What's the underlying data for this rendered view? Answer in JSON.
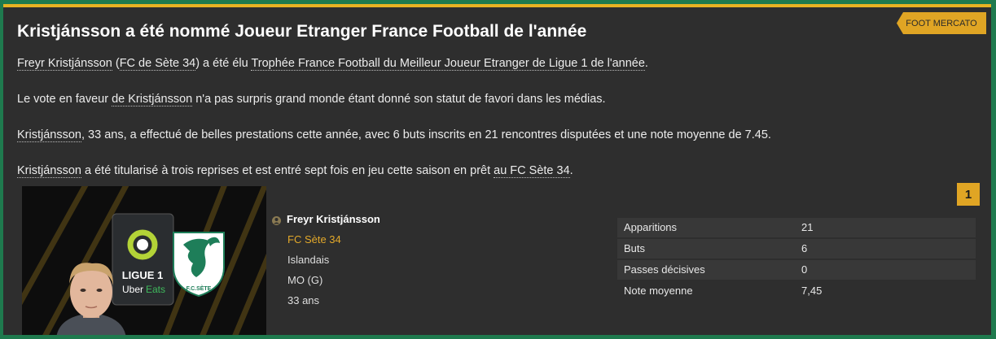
{
  "source": "FOOT MERCATO",
  "headline": "Kristjánsson a été nommé Joueur Etranger France Football de l'année",
  "paragraphs": {
    "p1": {
      "player": "Freyr Kristjánsson",
      "open_paren": " (",
      "club": "FC de Sète 34",
      "middle": ") a été élu ",
      "award": "Trophée France Football du Meilleur Joueur Etranger de Ligue 1 de l'année",
      "end": "."
    },
    "p2": {
      "start": "Le vote en faveur ",
      "player": "de Kristjánsson",
      "end": " n'a pas surpris grand monde étant donné son statut de favori dans les médias."
    },
    "p3": {
      "player": "Kristjánsson",
      "end": ", 33 ans, a effectué de belles prestations cette année, avec 6 buts inscrits en 21 rencontres disputées et une note moyenne de 7.45."
    },
    "p4": {
      "player": "Kristjánsson",
      "middle": " a été titularisé à trois reprises et est entré sept fois en jeu cette saison en prêt ",
      "club": "au FC Sète 34",
      "end": "."
    }
  },
  "rank": "1",
  "league_logo": {
    "line1": "LIGUE 1",
    "sponsor1": "Uber",
    "sponsor2": "Eats"
  },
  "club_logo": {
    "text": "F.C.SÈTE"
  },
  "player_info": {
    "name": "Freyr Kristjánsson",
    "club": "FC Sète 34",
    "nationality": "Islandais",
    "position": "MO (G)",
    "age": "33 ans"
  },
  "stats": [
    {
      "label": "Apparitions",
      "value": "21"
    },
    {
      "label": "Buts",
      "value": "6"
    },
    {
      "label": "Passes décisives",
      "value": "0"
    },
    {
      "label": "Note moyenne",
      "value": "7,45"
    }
  ],
  "colors": {
    "accent": "#e0a524",
    "background": "#2e2e2e",
    "frame": "#1f7a4e",
    "club_text": "#e2a82a"
  }
}
